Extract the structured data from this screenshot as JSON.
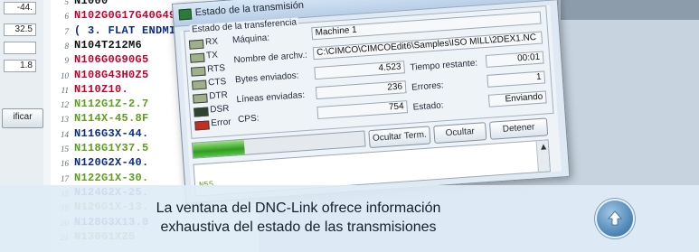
{
  "left_panel": {
    "fields": [
      "-44.",
      "32.5",
      "",
      "1.8"
    ],
    "button_label": "ificar"
  },
  "editor": {
    "lines": [
      {
        "n": "5",
        "code": "N1000",
        "color": "c-black"
      },
      {
        "n": "6",
        "code": "N102G0G17G40G49G80G90",
        "color": "c-red"
      },
      {
        "n": "7",
        "code": "( 3. FLAT ENDMILL TOOL - 212 DIA. OFF",
        "color": "c-navy"
      },
      {
        "n": "8",
        "code": "N104T212M6",
        "color": "c-black"
      },
      {
        "n": "9",
        "code": "N106G0G90G5",
        "color": "c-red"
      },
      {
        "n": "10",
        "code": "N108G43H0Z5",
        "color": "c-red"
      },
      {
        "n": "11",
        "code": "N110Z10.",
        "color": "c-red"
      },
      {
        "n": "12",
        "code": "N112G1Z-2.7",
        "color": "c-green"
      },
      {
        "n": "13",
        "code": "N114X-45.8F",
        "color": "c-green"
      },
      {
        "n": "14",
        "code": "N116G3X-44.",
        "color": "c-navy"
      },
      {
        "n": "15",
        "code": "N118G1Y37.5",
        "color": "c-green"
      },
      {
        "n": "16",
        "code": "N120G2X-40.",
        "color": "c-navy"
      },
      {
        "n": "17",
        "code": "N122G1X-30.",
        "color": "c-green"
      },
      {
        "n": "18",
        "code": "N124G2X-25.",
        "color": "c-navy"
      },
      {
        "n": "19",
        "code": "N126G1X-13.",
        "color": "c-green"
      },
      {
        "n": "20",
        "code": "N128G3X13.0",
        "color": "c-navy"
      },
      {
        "n": "21",
        "code": "N130G1X25",
        "color": "c-green"
      }
    ]
  },
  "dialog": {
    "title": "Estado de la transmisión",
    "help_label": "?",
    "close_label": "X",
    "group_title": "Estado de la transferencia",
    "leds": [
      {
        "label": "RX",
        "state": "off"
      },
      {
        "label": "TX",
        "state": "off"
      },
      {
        "label": "RTS",
        "state": "off"
      },
      {
        "label": "CTS",
        "state": "off"
      },
      {
        "label": "DTR",
        "state": "off"
      },
      {
        "label": "DSR",
        "state": "dark"
      },
      {
        "label": "Error",
        "state": "red"
      }
    ],
    "machine_label": "Máquina:",
    "machine_value": "Machine 1",
    "file_label": "Nombre de archv.:",
    "file_value": "C:\\CIMCO\\CIMCOEdit6\\Samples\\ISO MILL\\2DEX1.NC",
    "bytes_label": "Bytes enviados:",
    "bytes_value": "4.523",
    "lines_label": "Líneas enviadas:",
    "lines_value": "236",
    "cps_label": "CPS:",
    "cps_value": "754",
    "remaining_label": "Tiempo restante:",
    "remaining_value": "00:01",
    "errors_label": "Errores:",
    "errors_value": "1",
    "status_label": "Estado:",
    "status_value": "Enviando",
    "progress_fraction": 0.3,
    "btn_hide_term": "Ocultar Term.",
    "btn_hide": "Ocultar",
    "btn_stop": "Detener",
    "terminal_text": "N55"
  },
  "caption": {
    "line1": "La ventana del DNC-Link ofrece información",
    "line2": "exhaustiva del estado de las transmisiones"
  }
}
